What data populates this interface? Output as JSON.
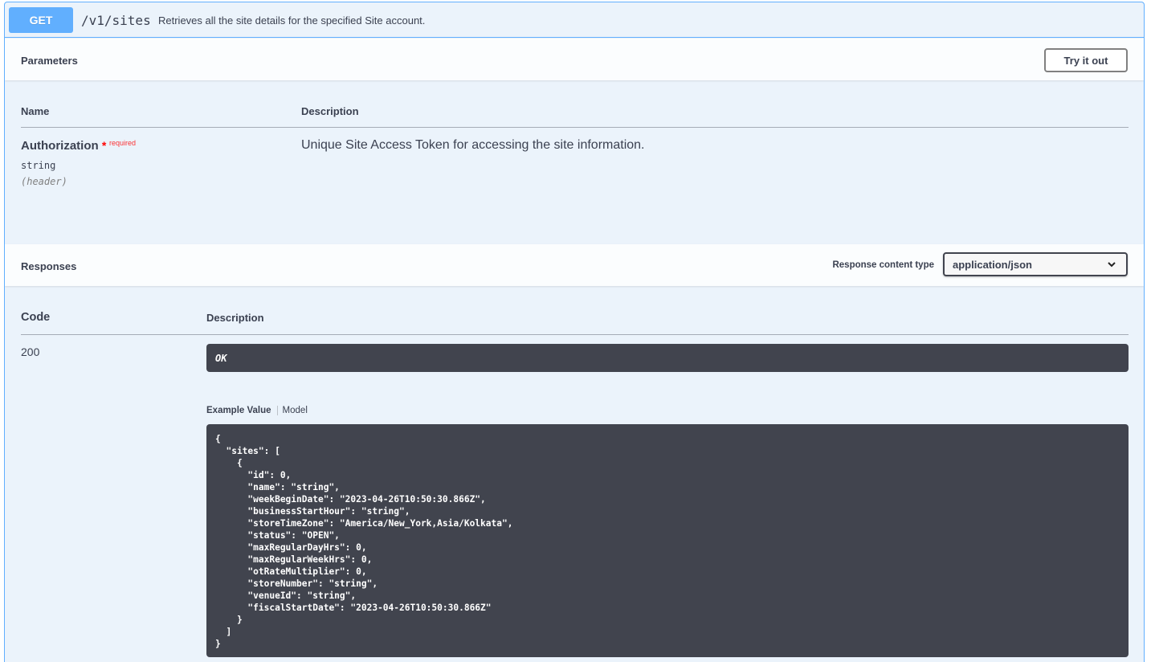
{
  "summary": {
    "method": "GET",
    "path": "/v1/sites",
    "description": "Retrieves all the site details for the specified Site account."
  },
  "parameters": {
    "title": "Parameters",
    "try_label": "Try it out",
    "col_name": "Name",
    "col_description": "Description",
    "items": [
      {
        "name": "Authorization",
        "star": "*",
        "required": "required",
        "type": "string",
        "in": "(header)",
        "description": "Unique Site Access Token for accessing the site information."
      }
    ]
  },
  "responses": {
    "title": "Responses",
    "content_type_label": "Response content type",
    "content_type": "application/json",
    "col_code": "Code",
    "col_description": "Description",
    "items": [
      {
        "code": "200",
        "description": "OK",
        "tab_example": "Example Value",
        "tab_model": "Model",
        "example": "{\n  \"sites\": [\n    {\n      \"id\": 0,\n      \"name\": \"string\",\n      \"weekBeginDate\": \"2023-04-26T10:50:30.866Z\",\n      \"businessStartHour\": \"string\",\n      \"storeTimeZone\": \"America/New_York,Asia/Kolkata\",\n      \"status\": \"OPEN\",\n      \"maxRegularDayHrs\": 0,\n      \"maxRegularWeekHrs\": 0,\n      \"otRateMultiplier\": 0,\n      \"storeNumber\": \"string\",\n      \"venueId\": \"string\",\n      \"fiscalStartDate\": \"2023-04-26T10:50:30.866Z\"\n    }\n  ]\n}"
      }
    ]
  },
  "colors": {
    "get_blue": "#61affe",
    "panel_bg": "#ebf3fb",
    "code_bg": "#41444e",
    "required_red": "#ff0000"
  },
  "icons": {
    "dropdown": "chevron-down-icon"
  }
}
